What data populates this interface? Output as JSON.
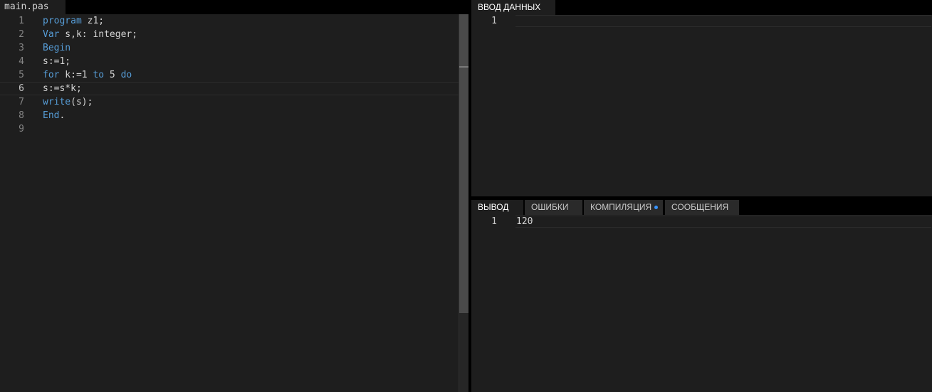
{
  "editor": {
    "file_tab": "main.pas",
    "lines": [
      {
        "n": "1",
        "tokens": [
          {
            "t": "program",
            "c": "kw"
          },
          {
            "t": " z1;",
            "c": ""
          }
        ]
      },
      {
        "n": "2",
        "tokens": [
          {
            "t": "Var",
            "c": "kw"
          },
          {
            "t": " s,k: integer;",
            "c": ""
          }
        ]
      },
      {
        "n": "3",
        "tokens": [
          {
            "t": "Begin",
            "c": "kw"
          }
        ]
      },
      {
        "n": "4",
        "tokens": [
          {
            "t": "s:=1;",
            "c": ""
          }
        ]
      },
      {
        "n": "5",
        "tokens": [
          {
            "t": "for",
            "c": "kw"
          },
          {
            "t": " k:=1 ",
            "c": ""
          },
          {
            "t": "to",
            "c": "kw"
          },
          {
            "t": " 5 ",
            "c": ""
          },
          {
            "t": "do",
            "c": "kw"
          }
        ]
      },
      {
        "n": "6",
        "tokens": [
          {
            "t": "s:=s*k;",
            "c": ""
          }
        ],
        "current": true
      },
      {
        "n": "7",
        "tokens": [
          {
            "t": "write",
            "c": "kw"
          },
          {
            "t": "(s);",
            "c": ""
          }
        ]
      },
      {
        "n": "8",
        "tokens": [
          {
            "t": "End",
            "c": "kw"
          },
          {
            "t": ".",
            "c": ""
          }
        ]
      },
      {
        "n": "9",
        "tokens": []
      }
    ]
  },
  "input_panel": {
    "tab": "ВВОД  ДАННЫХ",
    "line_number": "1",
    "value": ""
  },
  "output_panel": {
    "tabs": {
      "output": "ВЫВОД",
      "errors": "ОШИБКИ",
      "compilation": "КОМПИЛЯЦИЯ",
      "messages": "СООБЩЕНИЯ"
    },
    "line_number": "1",
    "value": "120"
  },
  "colors": {
    "keyword": "#569cd6",
    "text": "#d4d4d4",
    "background": "#1e1e1e",
    "indicator": "#3794ff"
  }
}
